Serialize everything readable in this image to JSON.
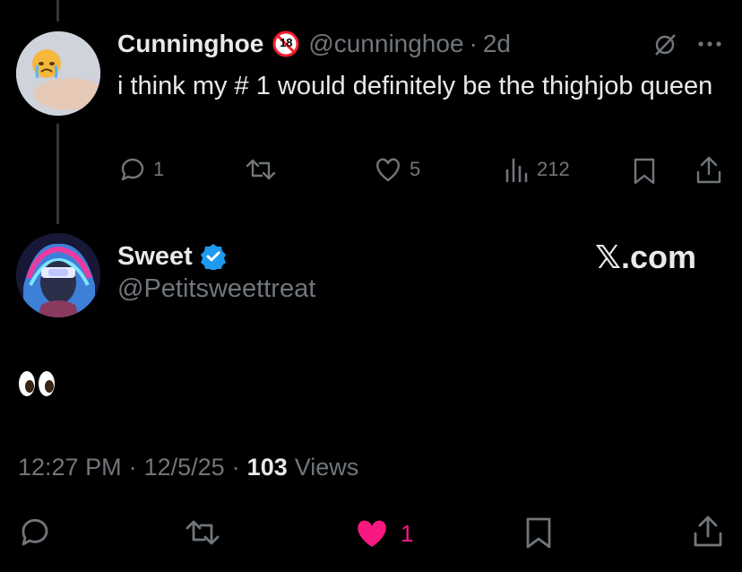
{
  "parent": {
    "display_name": "Cunninghoe",
    "badge": "18",
    "handle": "@cunninghoe",
    "separator": "·",
    "age": "2d",
    "text": "i think my # 1 would definitely be the thighjob queen",
    "stats": {
      "replies": "1",
      "likes": "5",
      "views": "212"
    }
  },
  "tweet": {
    "display_name": "Sweet",
    "handle": "@Petitsweettreat",
    "brand": "𝕏.com",
    "text": "👀",
    "time": "12:27 PM",
    "sep1": "·",
    "date": "12/5/25",
    "sep2": "·",
    "views_count": "103",
    "views_label": "Views",
    "likes": "1"
  },
  "colors": {
    "like_active": "#f91880",
    "verified": "#1d9bf0",
    "muted": "#71767b",
    "badge_red": "#f4212e"
  }
}
